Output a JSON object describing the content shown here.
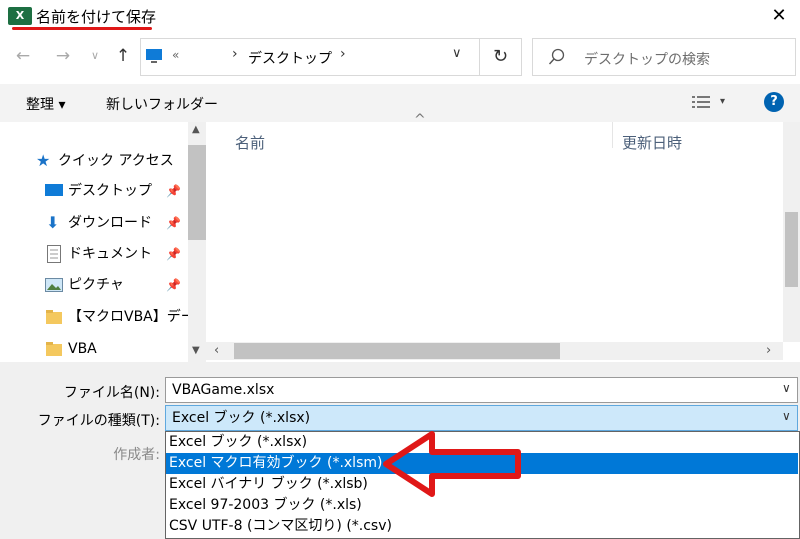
{
  "window": {
    "title": "名前を付けて保存",
    "app_icon_letter": "X",
    "close_glyph": "✕"
  },
  "address": {
    "overflow": "«",
    "location": "デスクトップ",
    "search_placeholder": "デスクトップの検索"
  },
  "toolbar": {
    "organize_label": "整理 ▾",
    "new_folder_label": "新しいフォルダー",
    "view_caret": "▾",
    "help_glyph": "?"
  },
  "nav": {
    "items": [
      {
        "label": "クイック アクセス",
        "icon": "star-icon"
      },
      {
        "label": "デスクトップ",
        "icon": "desktop-icon",
        "pinned": true
      },
      {
        "label": "ダウンロード",
        "icon": "download-icon",
        "pinned": true
      },
      {
        "label": "ドキュメント",
        "icon": "document-icon",
        "pinned": true
      },
      {
        "label": "ピクチャ",
        "icon": "pictures-icon",
        "pinned": true
      },
      {
        "label": "【マクロVBA】データ",
        "icon": "folder-icon"
      },
      {
        "label": "VBA",
        "icon": "folder-icon"
      }
    ]
  },
  "filelist": {
    "columns": [
      "名前",
      "更新日時"
    ],
    "sort_glyph": "^"
  },
  "form": {
    "filename_label": "ファイル名(N):",
    "filename_value": "VBAGame.xlsx",
    "filetype_label": "ファイルの種類(T):",
    "filetype_value": "Excel ブック (*.xlsx)",
    "author_label": "作成者:",
    "filetype_options": [
      "Excel ブック (*.xlsx)",
      "Excel マクロ有効ブック (*.xlsm)",
      "Excel バイナリ ブック (*.xlsb)",
      "Excel 97-2003 ブック (*.xls)",
      "CSV UTF-8 (コンマ区切り) (*.csv)"
    ],
    "selected_option_index": 1
  },
  "colors": {
    "accent": "#0078d7",
    "annotation_red": "#e01818",
    "excel_green": "#1d6f42"
  }
}
